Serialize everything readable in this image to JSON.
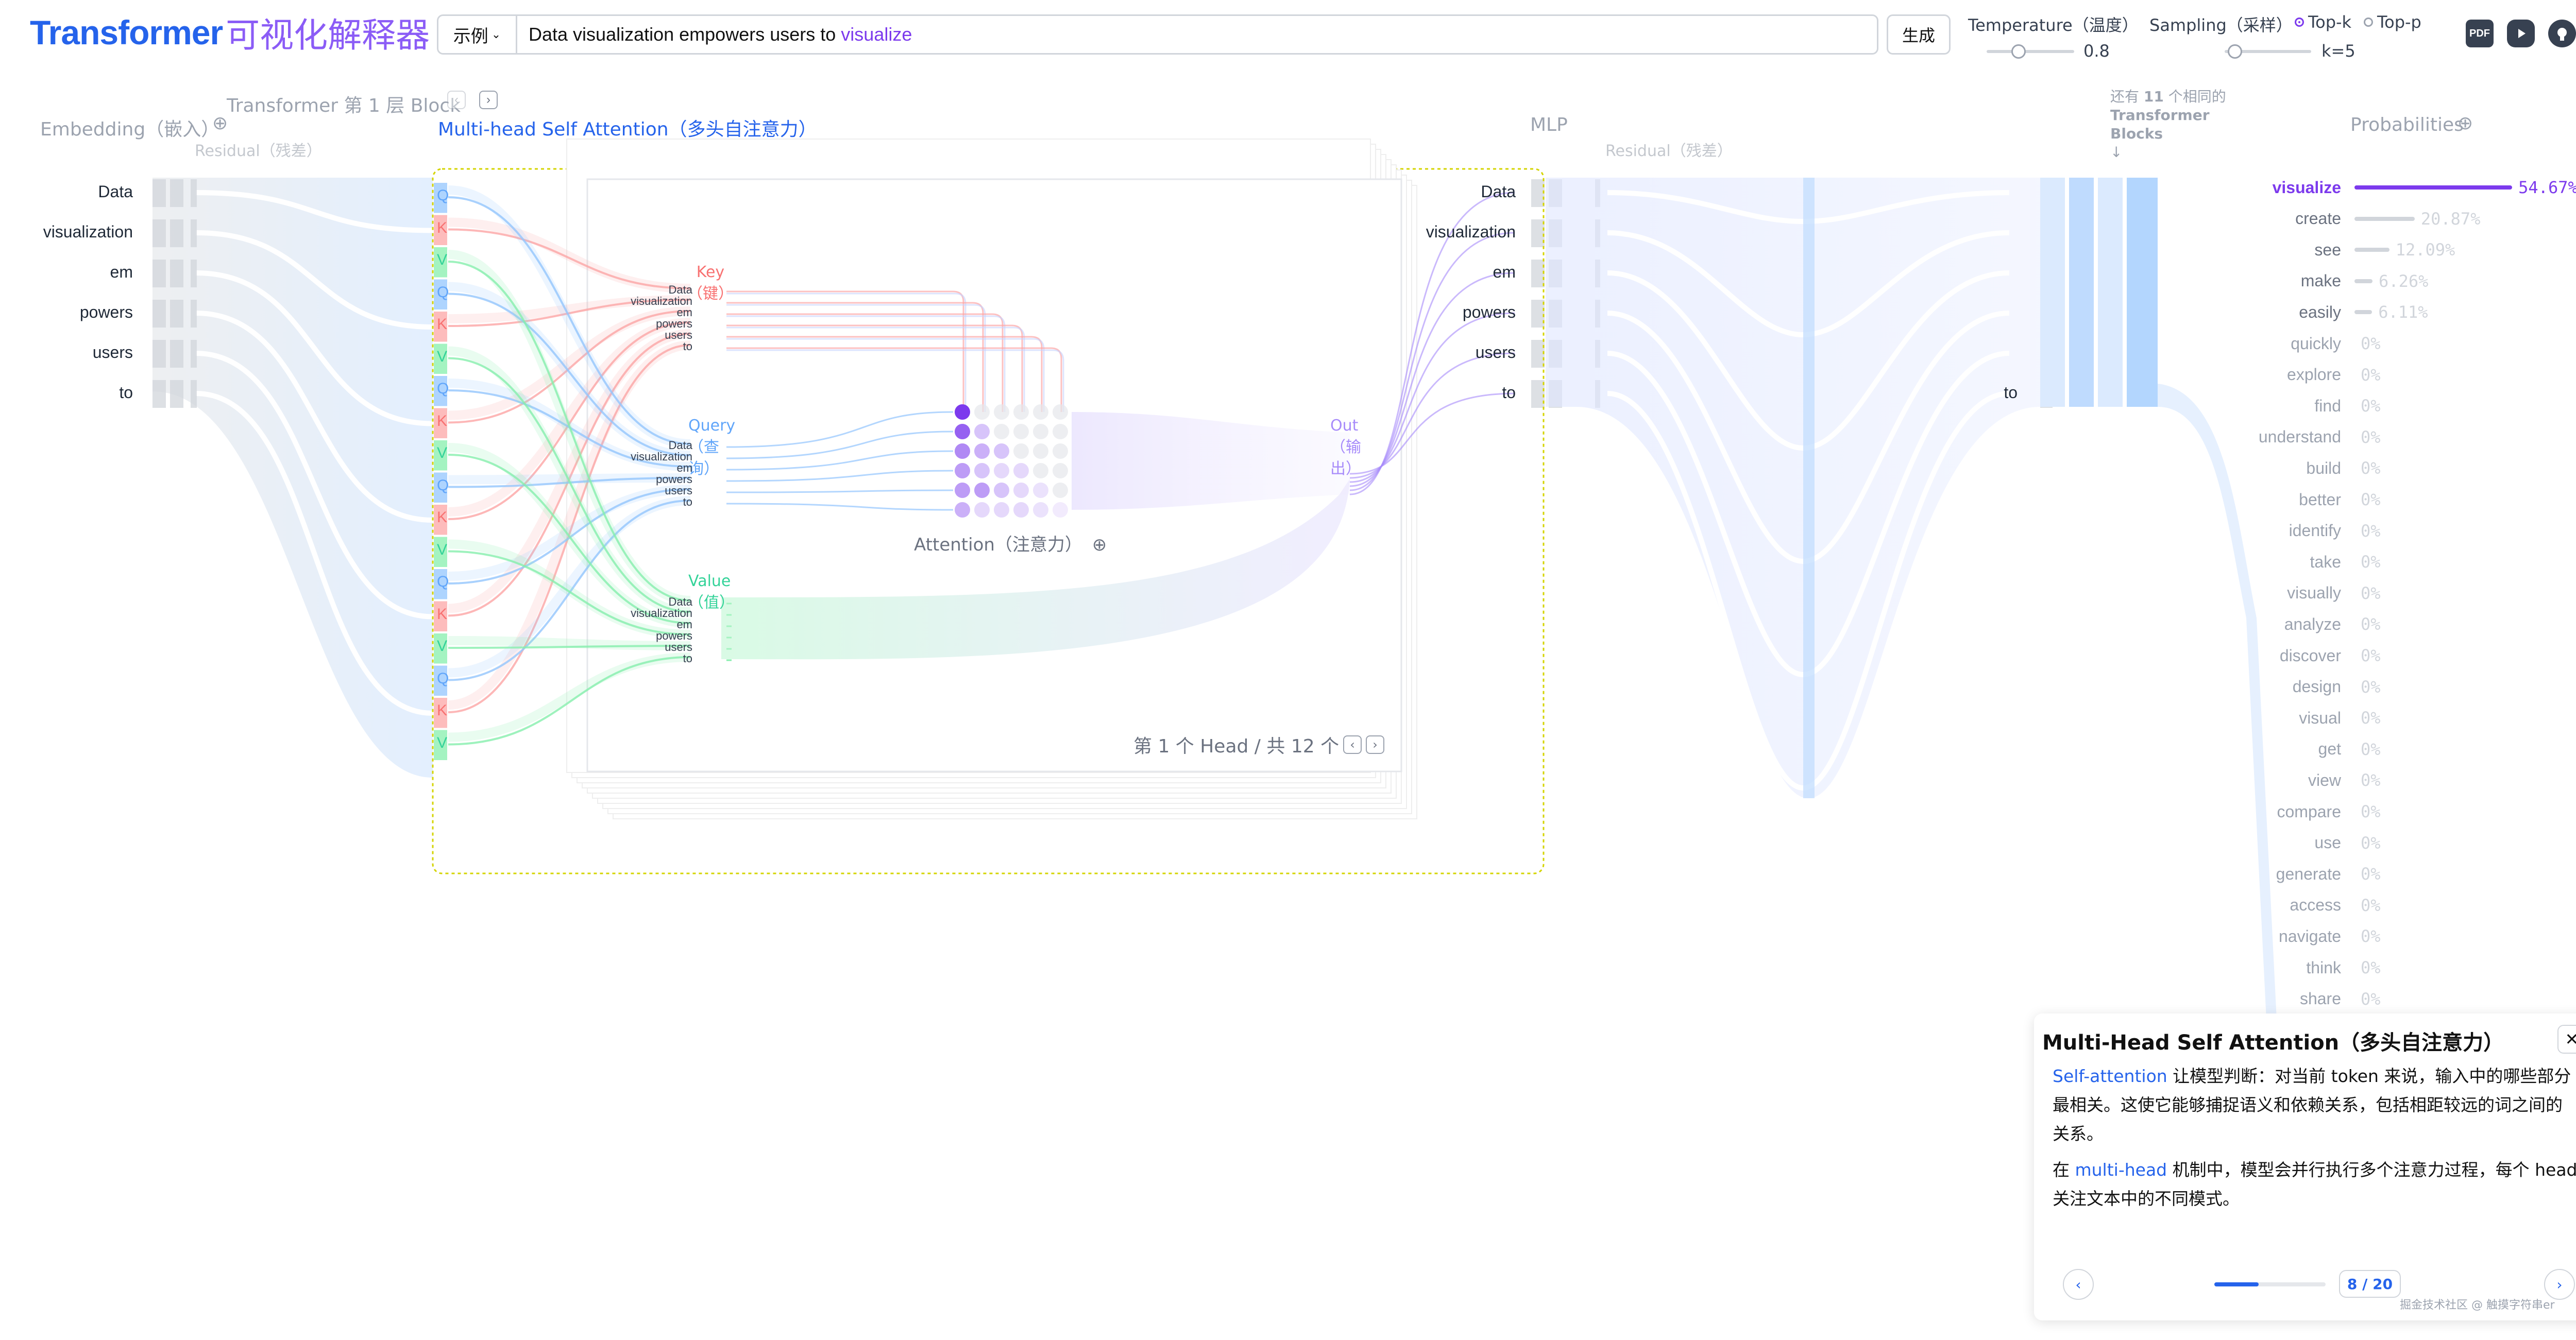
{
  "header": {
    "logo_en": "Transformer",
    "logo_zh": "可视化解释器",
    "example_button": "示例",
    "prompt_text": "Data visualization empowers users to",
    "prompt_prediction": "visualize",
    "generate_button": "生成",
    "temperature_label": "Temperature（温度）",
    "temperature_value": "0.8",
    "sampling_label": "Sampling（采样）",
    "topk_label": "Top-k",
    "topp_label": "Top-p",
    "k_value": "k=5",
    "icons": [
      "pdf-icon",
      "youtube-icon",
      "github-icon"
    ],
    "pdf_icon_text": "PDF"
  },
  "sections": {
    "embedding": "Embedding（嵌入）",
    "block": "Transformer 第 1 层 Block",
    "attention": "Multi-head Self Attention（多头自注意力）",
    "mlp": "MLP",
    "residual": "Residual（残差）",
    "more_blocks_1": "还有",
    "more_blocks_n": "11",
    "more_blocks_2": "个相同的",
    "more_blocks_3": "Transformer",
    "more_blocks_4": "Blocks",
    "probabilities": "Probabilities"
  },
  "tokens": [
    "Data",
    "visualization",
    "em",
    "powers",
    "users",
    "to"
  ],
  "mlp_last_token": "to",
  "qkv": {
    "key": "Key",
    "key_zh": "（键）",
    "query": "Query",
    "query_zh1": "（查",
    "query_zh2": "询）",
    "value": "Value",
    "value_zh": "（值）",
    "out": "Out",
    "out_zh1": "（输",
    "out_zh2": "出）",
    "q": "Q",
    "k": "K",
    "v": "V"
  },
  "attention": {
    "label": "Attention（注意力）",
    "head_text": "第 1 个 Head / 共 12 个"
  },
  "probabilities": [
    {
      "word": "visualize",
      "value": "54.67%",
      "frac": 0.5467
    },
    {
      "word": "create",
      "value": "20.87%",
      "frac": 0.2087
    },
    {
      "word": "see",
      "value": "12.09%",
      "frac": 0.1209
    },
    {
      "word": "make",
      "value": "6.26%",
      "frac": 0.0626
    },
    {
      "word": "easily",
      "value": "6.11%",
      "frac": 0.0611
    },
    {
      "word": "quickly",
      "value": "0%",
      "frac": 0
    },
    {
      "word": "explore",
      "value": "0%",
      "frac": 0
    },
    {
      "word": "find",
      "value": "0%",
      "frac": 0
    },
    {
      "word": "understand",
      "value": "0%",
      "frac": 0
    },
    {
      "word": "build",
      "value": "0%",
      "frac": 0
    },
    {
      "word": "better",
      "value": "0%",
      "frac": 0
    },
    {
      "word": "identify",
      "value": "0%",
      "frac": 0
    },
    {
      "word": "take",
      "value": "0%",
      "frac": 0
    },
    {
      "word": "visually",
      "value": "0%",
      "frac": 0
    },
    {
      "word": "analyze",
      "value": "0%",
      "frac": 0
    },
    {
      "word": "discover",
      "value": "0%",
      "frac": 0
    },
    {
      "word": "design",
      "value": "0%",
      "frac": 0
    },
    {
      "word": "visual",
      "value": "0%",
      "frac": 0
    },
    {
      "word": "get",
      "value": "0%",
      "frac": 0
    },
    {
      "word": "view",
      "value": "0%",
      "frac": 0
    },
    {
      "word": "compare",
      "value": "0%",
      "frac": 0
    },
    {
      "word": "use",
      "value": "0%",
      "frac": 0
    },
    {
      "word": "generate",
      "value": "0%",
      "frac": 0
    },
    {
      "word": "access",
      "value": "0%",
      "frac": 0
    },
    {
      "word": "navigate",
      "value": "0%",
      "frac": 0
    },
    {
      "word": "think",
      "value": "0%",
      "frac": 0
    },
    {
      "word": "share",
      "value": "0%",
      "frac": 0
    }
  ],
  "panel": {
    "title": "Multi-Head Self Attention（多头自注意力）",
    "p1_hl": "Self-attention",
    "p1_rest": " 让模型判断：对当前 token 来说，输入中的哪些部分最相关。这使它能够捕捉语义和依赖关系，包括相距较远的词之间的关系。",
    "p2_a": "在 ",
    "p2_hl": "multi-head",
    "p2_rest": " 机制中，模型会并行执行多个注意力过程，每个 head 关注文本中的不同模式。",
    "page": "8 / 20",
    "progress": 0.4,
    "watermark": "掘金技术社区 @ 触摸字符串er"
  },
  "colors": {
    "q": "#93c5fd",
    "k": "#fca5a5",
    "v": "#86efac",
    "accent": "#7c3aed",
    "blue": "#2563eb"
  }
}
